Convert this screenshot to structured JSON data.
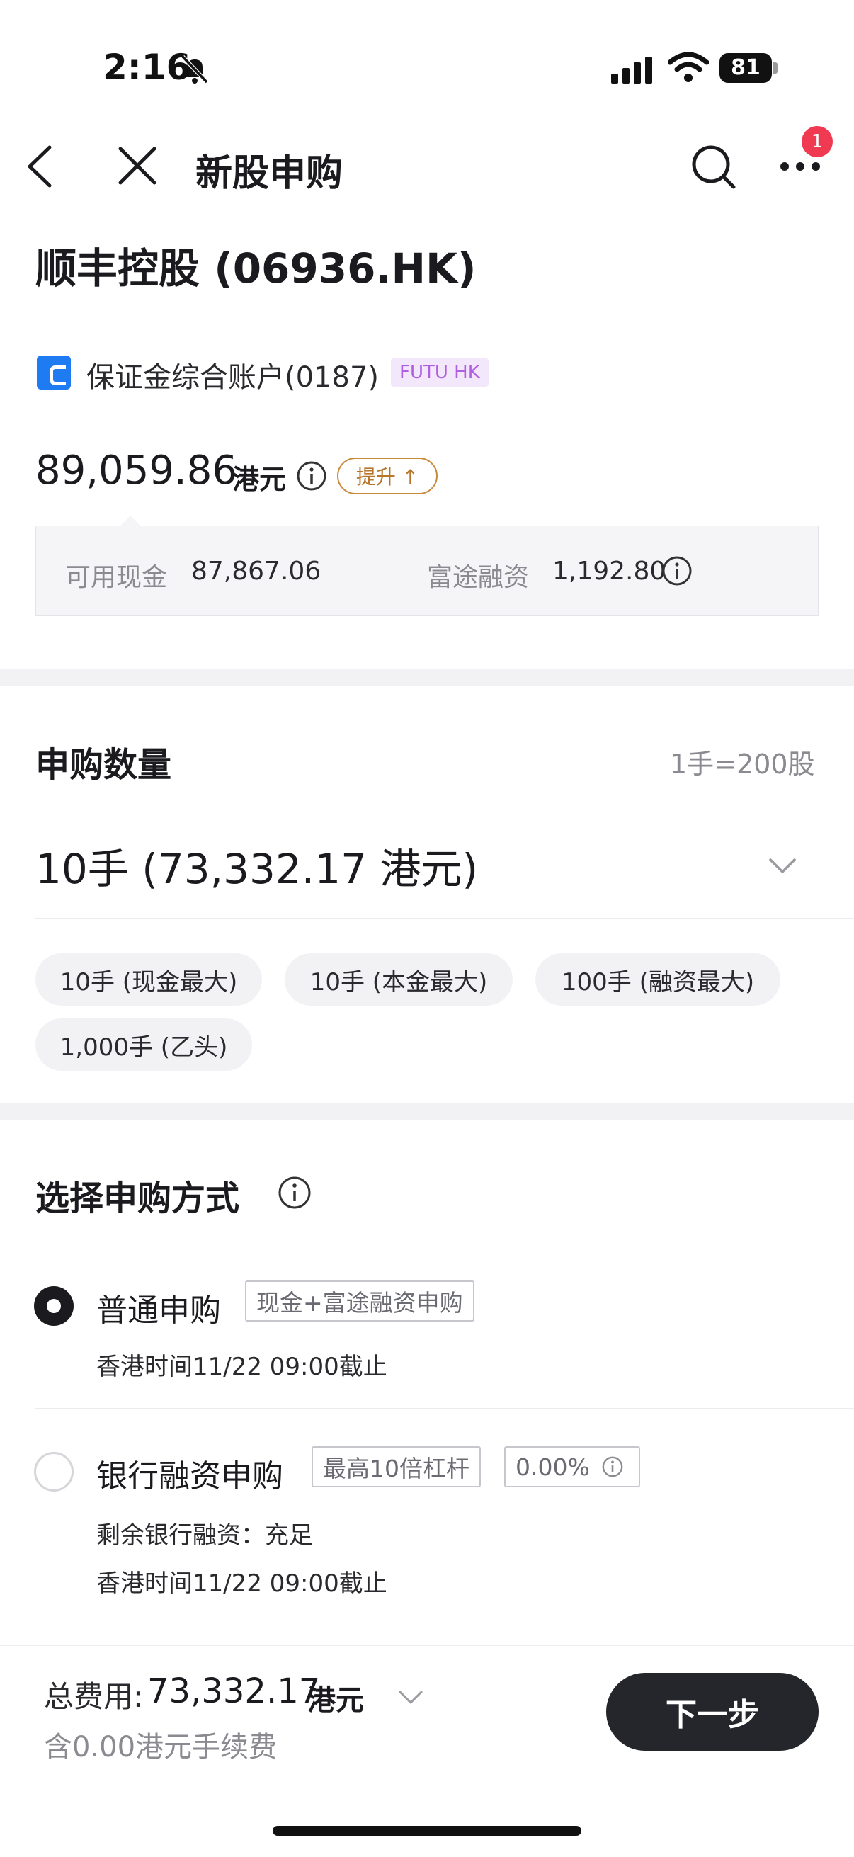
{
  "status_bar": {
    "time": "2:16",
    "battery": "81"
  },
  "nav": {
    "title": "新股申购",
    "badge_count": "1"
  },
  "stock": {
    "title": "顺丰控股 (06936.HK)"
  },
  "account": {
    "label": "保证金综合账户(0187)",
    "tag": "FUTU HK",
    "balance": "89,059.86",
    "currency": "港元",
    "upgrade_label": "提升 ↑",
    "cash_label": "可用现金",
    "cash_value": "87,867.06",
    "financing_label": "富途融资",
    "financing_value": "1,192.80"
  },
  "quantity": {
    "title": "申购数量",
    "lot_info": "1手=200股",
    "selected": "10手 (73,332.17 港元)",
    "chips": [
      "10手 (现金最大)",
      "10手 (本金最大)",
      "100手 (融资最大)",
      "1,000手 (乙头)"
    ]
  },
  "method": {
    "title": "选择申购方式",
    "options": [
      {
        "title": "普通申购",
        "tags": [
          "现金+富途融资申购"
        ],
        "lines": [
          "香港时间11/22 09:00截止"
        ],
        "selected": true
      },
      {
        "title": "银行融资申购",
        "tags": [
          "最高10倍杠杆",
          "0.00%"
        ],
        "lines": [
          "剩余银行融资：充足",
          "香港时间11/22 09:00截止"
        ],
        "selected": false
      }
    ]
  },
  "footer": {
    "total_label": "总费用:",
    "total_value": "73,332.17",
    "total_unit": "港元",
    "fee_note": "含0.00港元手续费",
    "next_label": "下一步"
  },
  "colors": {
    "accent_blue": "#1f7bf2",
    "badge_red": "#ef3a52",
    "tag_purple": "#b05fe0",
    "upgrade_gold": "#c98a3c",
    "button_dark": "#24262b"
  }
}
